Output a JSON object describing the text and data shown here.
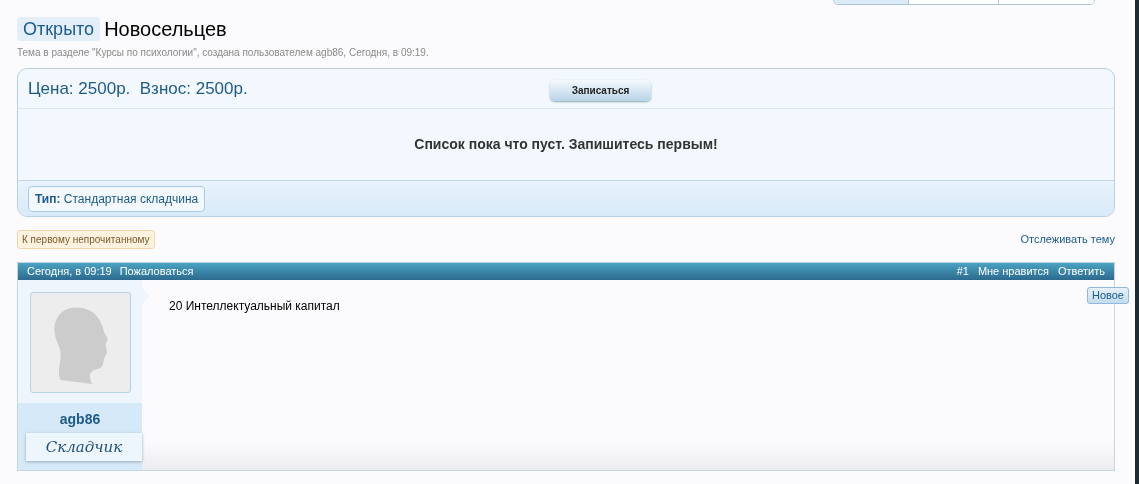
{
  "top_tabs": [
    {
      "selected": true
    },
    {
      "selected": false
    },
    {
      "selected": false
    }
  ],
  "thread": {
    "prefix": "Открыто",
    "title": "Новосельцев",
    "description": "Тема в разделе \"Курсы по психологии\", создана пользователем agb86, Сегодня, в 09:19."
  },
  "purchase_panel": {
    "price": "Цена: 2500р.  Взнос: 2500р.",
    "join_button": "Записаться",
    "empty_message": "Список пока что пуст. Запишитесь первым!",
    "type_label": "Тип:",
    "type_value": "Стандартная складчина"
  },
  "unread_link": "К первому непрочитанному",
  "watch_link": "Отслеживать тему",
  "post": {
    "date": "Сегодня, в 09:19",
    "report": "Пожаловаться",
    "number": "#1",
    "like": "Мне нравится",
    "reply": "Ответить",
    "new_badge": "Новое",
    "username": "agb86",
    "rank": "Складчик",
    "message": "20 Интеллектуальный капитал"
  }
}
